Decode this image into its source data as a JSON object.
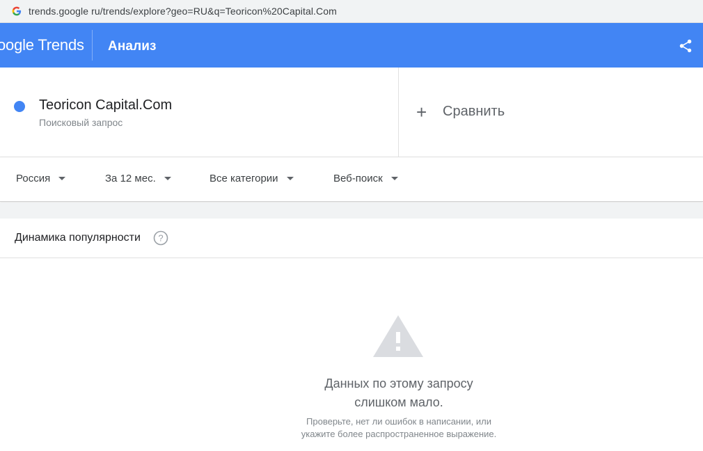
{
  "browser": {
    "url": "trends.google ru/trends/explore?geo=RU&q=Teoricon%20Capital.Com",
    "favicon": "google-g-icon"
  },
  "header": {
    "logo": "oogle Trends",
    "title": "Анализ",
    "share_icon": "share-icon",
    "background": "#4285f4"
  },
  "term": {
    "name": "Teoricon Capital.Com",
    "subtitle": "Поисковый запрос",
    "color": "#4285f4"
  },
  "compare": {
    "label": "Сравнить"
  },
  "filters": [
    {
      "label": "Россия"
    },
    {
      "label": "За 12 мес."
    },
    {
      "label": "Все категории"
    },
    {
      "label": "Веб-поиск"
    }
  ],
  "interest_card": {
    "title": "Динамика популярности",
    "empty_title": "Данных по этому запросу слишком мало.",
    "empty_title_line1": "Данных по этому запросу",
    "empty_title_line2": "слишком мало.",
    "empty_hint_line1": "Проверьте, нет ли ошибок в написании, или",
    "empty_hint_line2": "укажите более распространенное выражение."
  }
}
